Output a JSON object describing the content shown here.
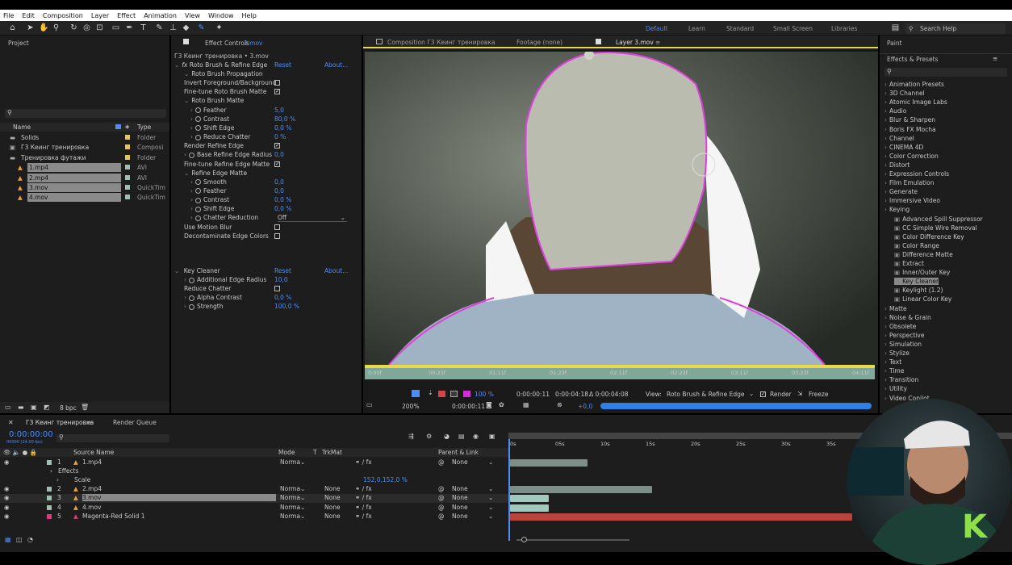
{
  "menu": [
    "File",
    "Edit",
    "Composition",
    "Layer",
    "Effect",
    "Animation",
    "View",
    "Window",
    "Help"
  ],
  "workspaces": [
    "Default",
    "Learn",
    "Standard",
    "Small Screen",
    "Libraries"
  ],
  "search_help": "Search Help",
  "project": {
    "title": "Project",
    "col_name": "Name",
    "col_type": "Type",
    "items": [
      {
        "name": "Solids",
        "type": "Folder",
        "indent": 0,
        "selected": false
      },
      {
        "name": "Г3 Кеинг тренировка",
        "type": "Composi",
        "indent": 0,
        "selected": false
      },
      {
        "name": "Тренировка футажи",
        "type": "Folder",
        "indent": 0,
        "selected": false
      },
      {
        "name": "1.mp4",
        "type": "AVI",
        "indent": 1,
        "selected": true
      },
      {
        "name": "2.mp4",
        "type": "AVI",
        "indent": 1,
        "selected": true
      },
      {
        "name": "3.mov",
        "type": "QuickTim",
        "indent": 1,
        "selected": true
      },
      {
        "name": "4.mov",
        "type": "QuickTim",
        "indent": 1,
        "selected": true
      }
    ],
    "bpc": "8 bpc"
  },
  "effect_controls": {
    "tab": "Effect Controls",
    "tab_layer": "3.mov",
    "crumb": "Г3 Кеинг тренировка • 3.mov",
    "effect1": {
      "name": "Roto Brush & Refine Edge",
      "reset": "Reset",
      "about": "About..."
    },
    "props": [
      {
        "label": "Roto Brush Propagation",
        "indent": 1,
        "value": "",
        "kind": "group"
      },
      {
        "label": "Invert Foreground/Background",
        "indent": 1,
        "value": "",
        "kind": "check",
        "on": false
      },
      {
        "label": "Fine-tune Roto Brush Matte",
        "indent": 1,
        "value": "",
        "kind": "check",
        "on": true
      },
      {
        "label": "Roto Brush Matte",
        "indent": 1,
        "value": "",
        "kind": "group"
      },
      {
        "label": "Feather",
        "indent": 2,
        "value": "5,0",
        "kind": "num"
      },
      {
        "label": "Contrast",
        "indent": 2,
        "value": "80,0 %",
        "kind": "num"
      },
      {
        "label": "Shift Edge",
        "indent": 2,
        "value": "0,0 %",
        "kind": "num"
      },
      {
        "label": "Reduce Chatter",
        "indent": 2,
        "value": "0 %",
        "kind": "num"
      },
      {
        "label": "Render Refine Edge",
        "indent": 1,
        "value": "",
        "kind": "check",
        "on": true
      },
      {
        "label": "Base Refine Edge Radius",
        "indent": 1,
        "value": "0,0",
        "kind": "num"
      },
      {
        "label": "Fine-tune Refine Edge Matte",
        "indent": 1,
        "value": "",
        "kind": "check",
        "on": true
      },
      {
        "label": "Refine Edge Matte",
        "indent": 1,
        "value": "",
        "kind": "group"
      },
      {
        "label": "Smooth",
        "indent": 2,
        "value": "0,0",
        "kind": "num"
      },
      {
        "label": "Feather",
        "indent": 2,
        "value": "0,0",
        "kind": "num"
      },
      {
        "label": "Contrast",
        "indent": 2,
        "value": "0,0 %",
        "kind": "num"
      },
      {
        "label": "Shift Edge",
        "indent": 2,
        "value": "0,0 %",
        "kind": "num"
      },
      {
        "label": "Chatter Reduction",
        "indent": 2,
        "value": "Off",
        "kind": "select"
      },
      {
        "label": "Use Motion Blur",
        "indent": 1,
        "value": "",
        "kind": "check",
        "on": false
      },
      {
        "label": "Decontaminate Edge Colors",
        "indent": 1,
        "value": "",
        "kind": "check",
        "on": false
      }
    ],
    "effect2": {
      "name": "Key Cleaner",
      "reset": "Reset",
      "about": "About..."
    },
    "props2": [
      {
        "label": "Additional Edge Radius",
        "value": "10,0",
        "kind": "num"
      },
      {
        "label": "Reduce Chatter",
        "value": "",
        "kind": "check",
        "on": false
      },
      {
        "label": "Alpha Contrast",
        "value": "0,0 %",
        "kind": "num"
      },
      {
        "label": "Strength",
        "value": "100,0 %",
        "kind": "num"
      }
    ]
  },
  "viewer": {
    "tabs": [
      {
        "label": "Composition Г3 Кеинг тренировка"
      },
      {
        "label": "Footage (none)"
      },
      {
        "label": "Layer 3.mov"
      }
    ],
    "ruler": [
      "0:00f",
      "00:23f",
      "01:11f",
      "01:23f",
      "02:11f",
      "02:23f",
      "03:11f",
      "03:23f",
      "04:11f"
    ],
    "zoom_pct": "100 %",
    "time_start": "0:00:00:11",
    "time_end": "0:00:04:18",
    "duration": "Δ 0:00:04:08",
    "view_label": "View:",
    "view_value": "Roto Brush & Refine Edge",
    "render_label": "Render",
    "freeze_label": "Freeze",
    "zoom": "200%",
    "timecode": "0:00:00:11",
    "exposure": "+0,0"
  },
  "effects_panel": {
    "paint": "Paint",
    "title": "Effects & Presets",
    "search_placeholder": "",
    "categories": [
      "Animation Presets",
      "3D Channel",
      "Atomic Image Labs",
      "Audio",
      "Blur & Sharpen",
      "Boris FX Mocha",
      "Channel",
      "CINEMA 4D",
      "Color Correction",
      "Distort",
      "Expression Controls",
      "Film Emulation",
      "Generate",
      "Immersive Video",
      "Keying"
    ],
    "keying_items": [
      "Advanced Spill Suppressor",
      "CC Simple Wire Removal",
      "Color Difference Key",
      "Color Range",
      "Difference Matte",
      "Extract",
      "Inner/Outer Key",
      "Key Cleaner",
      "Keylight (1.2)",
      "Linear Color Key"
    ],
    "selected_item": "Key Cleaner",
    "more": [
      "Matte",
      "Noise & Grain",
      "Obsolete",
      "Perspective",
      "Simulation",
      "Stylize",
      "Text",
      "Time",
      "Transition",
      "Utility",
      "Video Copilot"
    ]
  },
  "timeline": {
    "tab": "Г3 Кеинг тренировка",
    "render_queue": "Render Queue",
    "timecode": "0:00:00:00",
    "frame_info": "00000 (24.00 fps)",
    "headers": {
      "source": "Source Name",
      "mode": "Mode",
      "t": "T",
      "trkmat": "TrkMat",
      "parent": "Parent & Link"
    },
    "ruler": [
      "0s",
      "05s",
      "10s",
      "15s",
      "20s",
      "25s",
      "30s",
      "35s"
    ],
    "layers": [
      {
        "num": "1",
        "name": "1.mp4",
        "mode": "Norma",
        "trk": "",
        "parent": "None",
        "color": "#9fbfb0"
      },
      {
        "num": "",
        "name": "Effects",
        "mode": "",
        "trk": "",
        "parent": "",
        "color": ""
      },
      {
        "num": "",
        "name": "Scale",
        "mode": "",
        "trk": "",
        "parent": "",
        "color": "",
        "value": "152,0,152,0 %"
      },
      {
        "num": "2",
        "name": "2.mp4",
        "mode": "Norma",
        "trk": "None",
        "parent": "None",
        "color": "#9fbfb0"
      },
      {
        "num": "3",
        "name": "3.mov",
        "mode": "Norma",
        "trk": "None",
        "parent": "None",
        "color": "#9fbfb0"
      },
      {
        "num": "4",
        "name": "4.mov",
        "mode": "Norma",
        "trk": "None",
        "parent": "None",
        "color": "#9fbfb0"
      },
      {
        "num": "5",
        "name": "Magenta-Red Solid 1",
        "mode": "Norma",
        "trk": "None",
        "parent": "None",
        "color": "#e0387a"
      }
    ]
  },
  "colors": {
    "accent": "#4c8df6",
    "matte_edge": "#e040e0",
    "solid": "#b9443c",
    "clip": "#7fa89b"
  }
}
